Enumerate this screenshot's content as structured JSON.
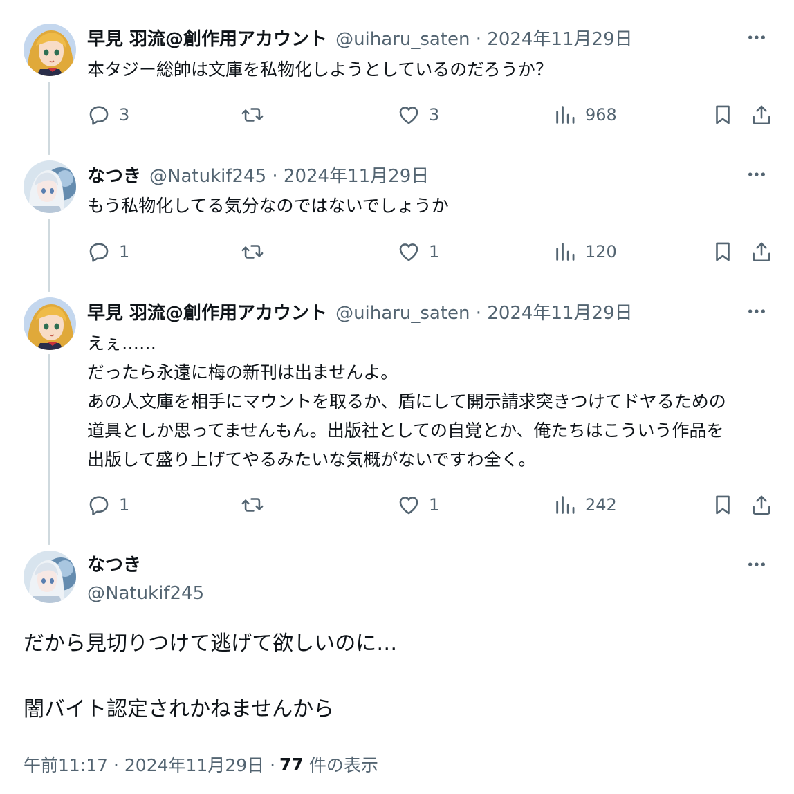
{
  "thread": [
    {
      "name": "早見 羽流@創作用アカウント",
      "meta": "@uiharu_saten · 2024年11月29日",
      "text": "本タジー総帥は文庫を私物化しようとしているのだろうか？",
      "replies": "3",
      "retweets": "",
      "likes": "3",
      "views": "968"
    },
    {
      "name": "なつき",
      "meta": "@Natukif245 · 2024年11月29日",
      "text": "もう私物化してる気分なのではないでしょうか",
      "replies": "1",
      "retweets": "",
      "likes": "1",
      "views": "120"
    },
    {
      "name": "早見 羽流@創作用アカウント",
      "meta": "@uiharu_saten · 2024年11月29日",
      "text": "えぇ……\nだったら永遠に梅の新刊は出ませんよ。\nあの人文庫を相手にマウントを取るか、盾にして開示請求突きつけてドヤるための\n道具としか思ってませんもん。出版社としての自覚とか、俺たちはこういう作品を\n出版して盛り上げてやるみたいな気概がないですわ全く。",
      "replies": "1",
      "retweets": "",
      "likes": "1",
      "views": "242"
    }
  ],
  "main_tweet": {
    "name": "なつき",
    "handle": "@Natukif245",
    "line1": "だから見切りつけて逃げて欲しいのに…",
    "line2": "闇バイト認定されかねませんから",
    "timestamp": "午前11:17 · 2024年11月29日 ·",
    "view_count": "77",
    "view_label": "件の表示"
  },
  "icons": [
    "more-icon",
    "reply-icon",
    "retweet-icon",
    "like-icon",
    "views-icon",
    "bookmark-icon",
    "share-icon"
  ],
  "colors": {
    "text": "#0f1419",
    "secondary": "#536471",
    "thread_line": "#cfd9de"
  }
}
